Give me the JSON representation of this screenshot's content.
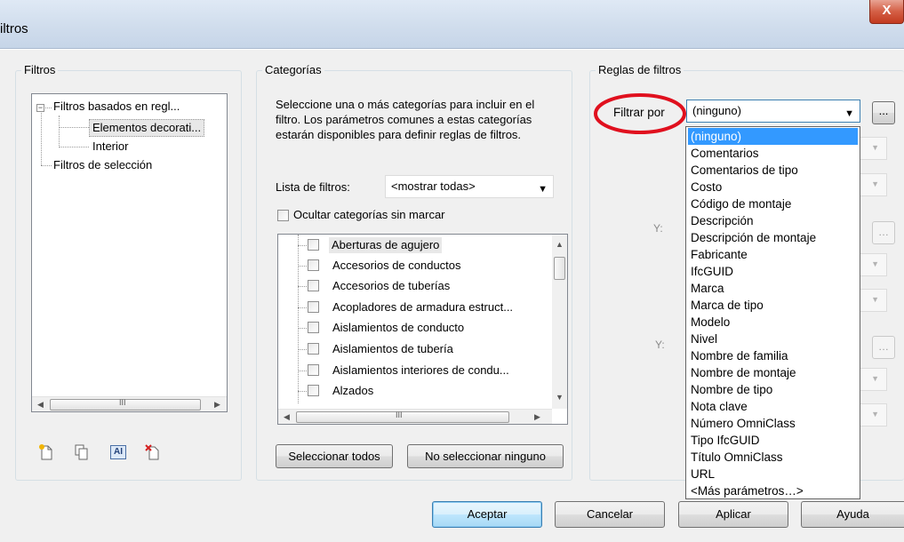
{
  "window": {
    "title": "iltros",
    "close_glyph": "X"
  },
  "filters_group": {
    "label": "Filtros",
    "tree": {
      "root": "Filtros basados en regl...",
      "root_expander": "−",
      "children": [
        "Elementos decorati...",
        "Interior"
      ],
      "selection": "Filtros de selección"
    },
    "hscroll_mark": "III",
    "toolbar_icons": [
      "new-filter-icon",
      "duplicate-filter-icon",
      "rename-filter-icon",
      "delete-filter-icon"
    ],
    "rename_icon_text": "AI"
  },
  "categories_group": {
    "label": "Categorías",
    "description": "Seleccione una o más categorías para incluir en el filtro. Los parámetros comunes a estas categorías estarán disponibles para definir reglas de filtros.",
    "filter_list_label": "Lista de filtros:",
    "filter_list_value": "<mostrar todas>",
    "hide_unchecked_label": "Ocultar categorías sin marcar",
    "items": [
      "Aberturas de agujero",
      "Accesorios de conductos",
      "Accesorios de tuberías",
      "Acopladores de armadura estruct...",
      "Aislamientos de conducto",
      "Aislamientos de tubería",
      "Aislamientos interiores de condu...",
      "Alzados"
    ],
    "hscroll_mark": "III",
    "select_all_label": "Seleccionar todos",
    "select_none_label": "No seleccionar ninguno"
  },
  "rules_group": {
    "label": "Reglas de filtros",
    "filter_by_label": "Filtrar por",
    "filter_by_value": "(ninguno)",
    "browse_label": "...",
    "y_label": "Y:",
    "dropdown_options": [
      "(ninguno)",
      "Comentarios",
      "Comentarios de tipo",
      "Costo",
      "Código de montaje",
      "Descripción",
      "Descripción de montaje",
      "Fabricante",
      "IfcGUID",
      "Marca",
      "Marca de tipo",
      "Modelo",
      "Nivel",
      "Nombre de familia",
      "Nombre de montaje",
      "Nombre de tipo",
      "Nota clave",
      "Número OmniClass",
      "Tipo IfcGUID",
      "Título OmniClass",
      "URL",
      "<Más parámetros…>"
    ],
    "selected_option": "(ninguno)"
  },
  "footer": {
    "ok_label": "Aceptar",
    "cancel_label": "Cancelar",
    "apply_label": "Aplicar",
    "help_label": "Ayuda"
  },
  "colors": {
    "selection": "#3399ff",
    "annotation_circle": "#e0101e",
    "default_button": "#a7d9f5"
  }
}
